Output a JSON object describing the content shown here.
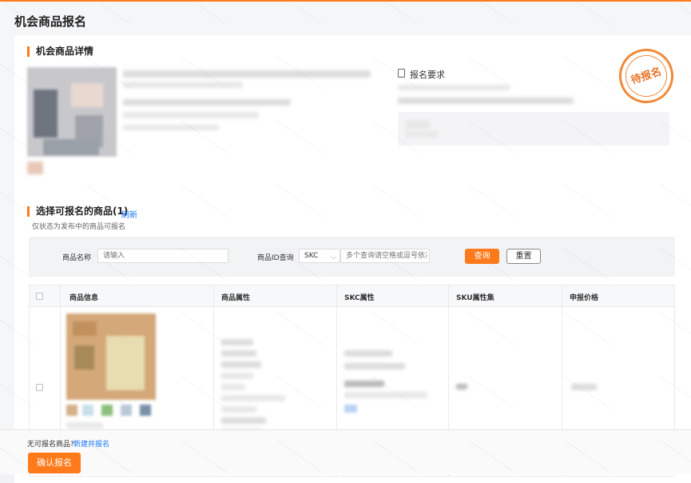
{
  "page": {
    "title": "机会商品报名"
  },
  "detail": {
    "section_title": "机会商品详情",
    "requirements_title": "报名要求",
    "status_stamp": "待报名"
  },
  "selection": {
    "section_title": "选择可报名的商品(1)",
    "refresh_label": "刷新",
    "note": "仅状态为发布中的商品可报名"
  },
  "filters": {
    "product_name_label": "商品名称",
    "product_name_placeholder": "请输入",
    "product_id_label": "商品ID查询",
    "id_type_selected": "SKC",
    "id_placeholder": "多个查询请空格或逗号依次$",
    "search_label": "查询",
    "reset_label": "重置"
  },
  "table": {
    "columns": [
      "商品信息",
      "商品属性",
      "SKC属性",
      "SKU属性集",
      "申报价格"
    ]
  },
  "footer": {
    "no_product_text": "无可报名商品?",
    "create_link": "新建并报名",
    "confirm_label": "确认报名"
  },
  "colors": {
    "accent": "#ff7a1a",
    "link": "#1677ff"
  }
}
